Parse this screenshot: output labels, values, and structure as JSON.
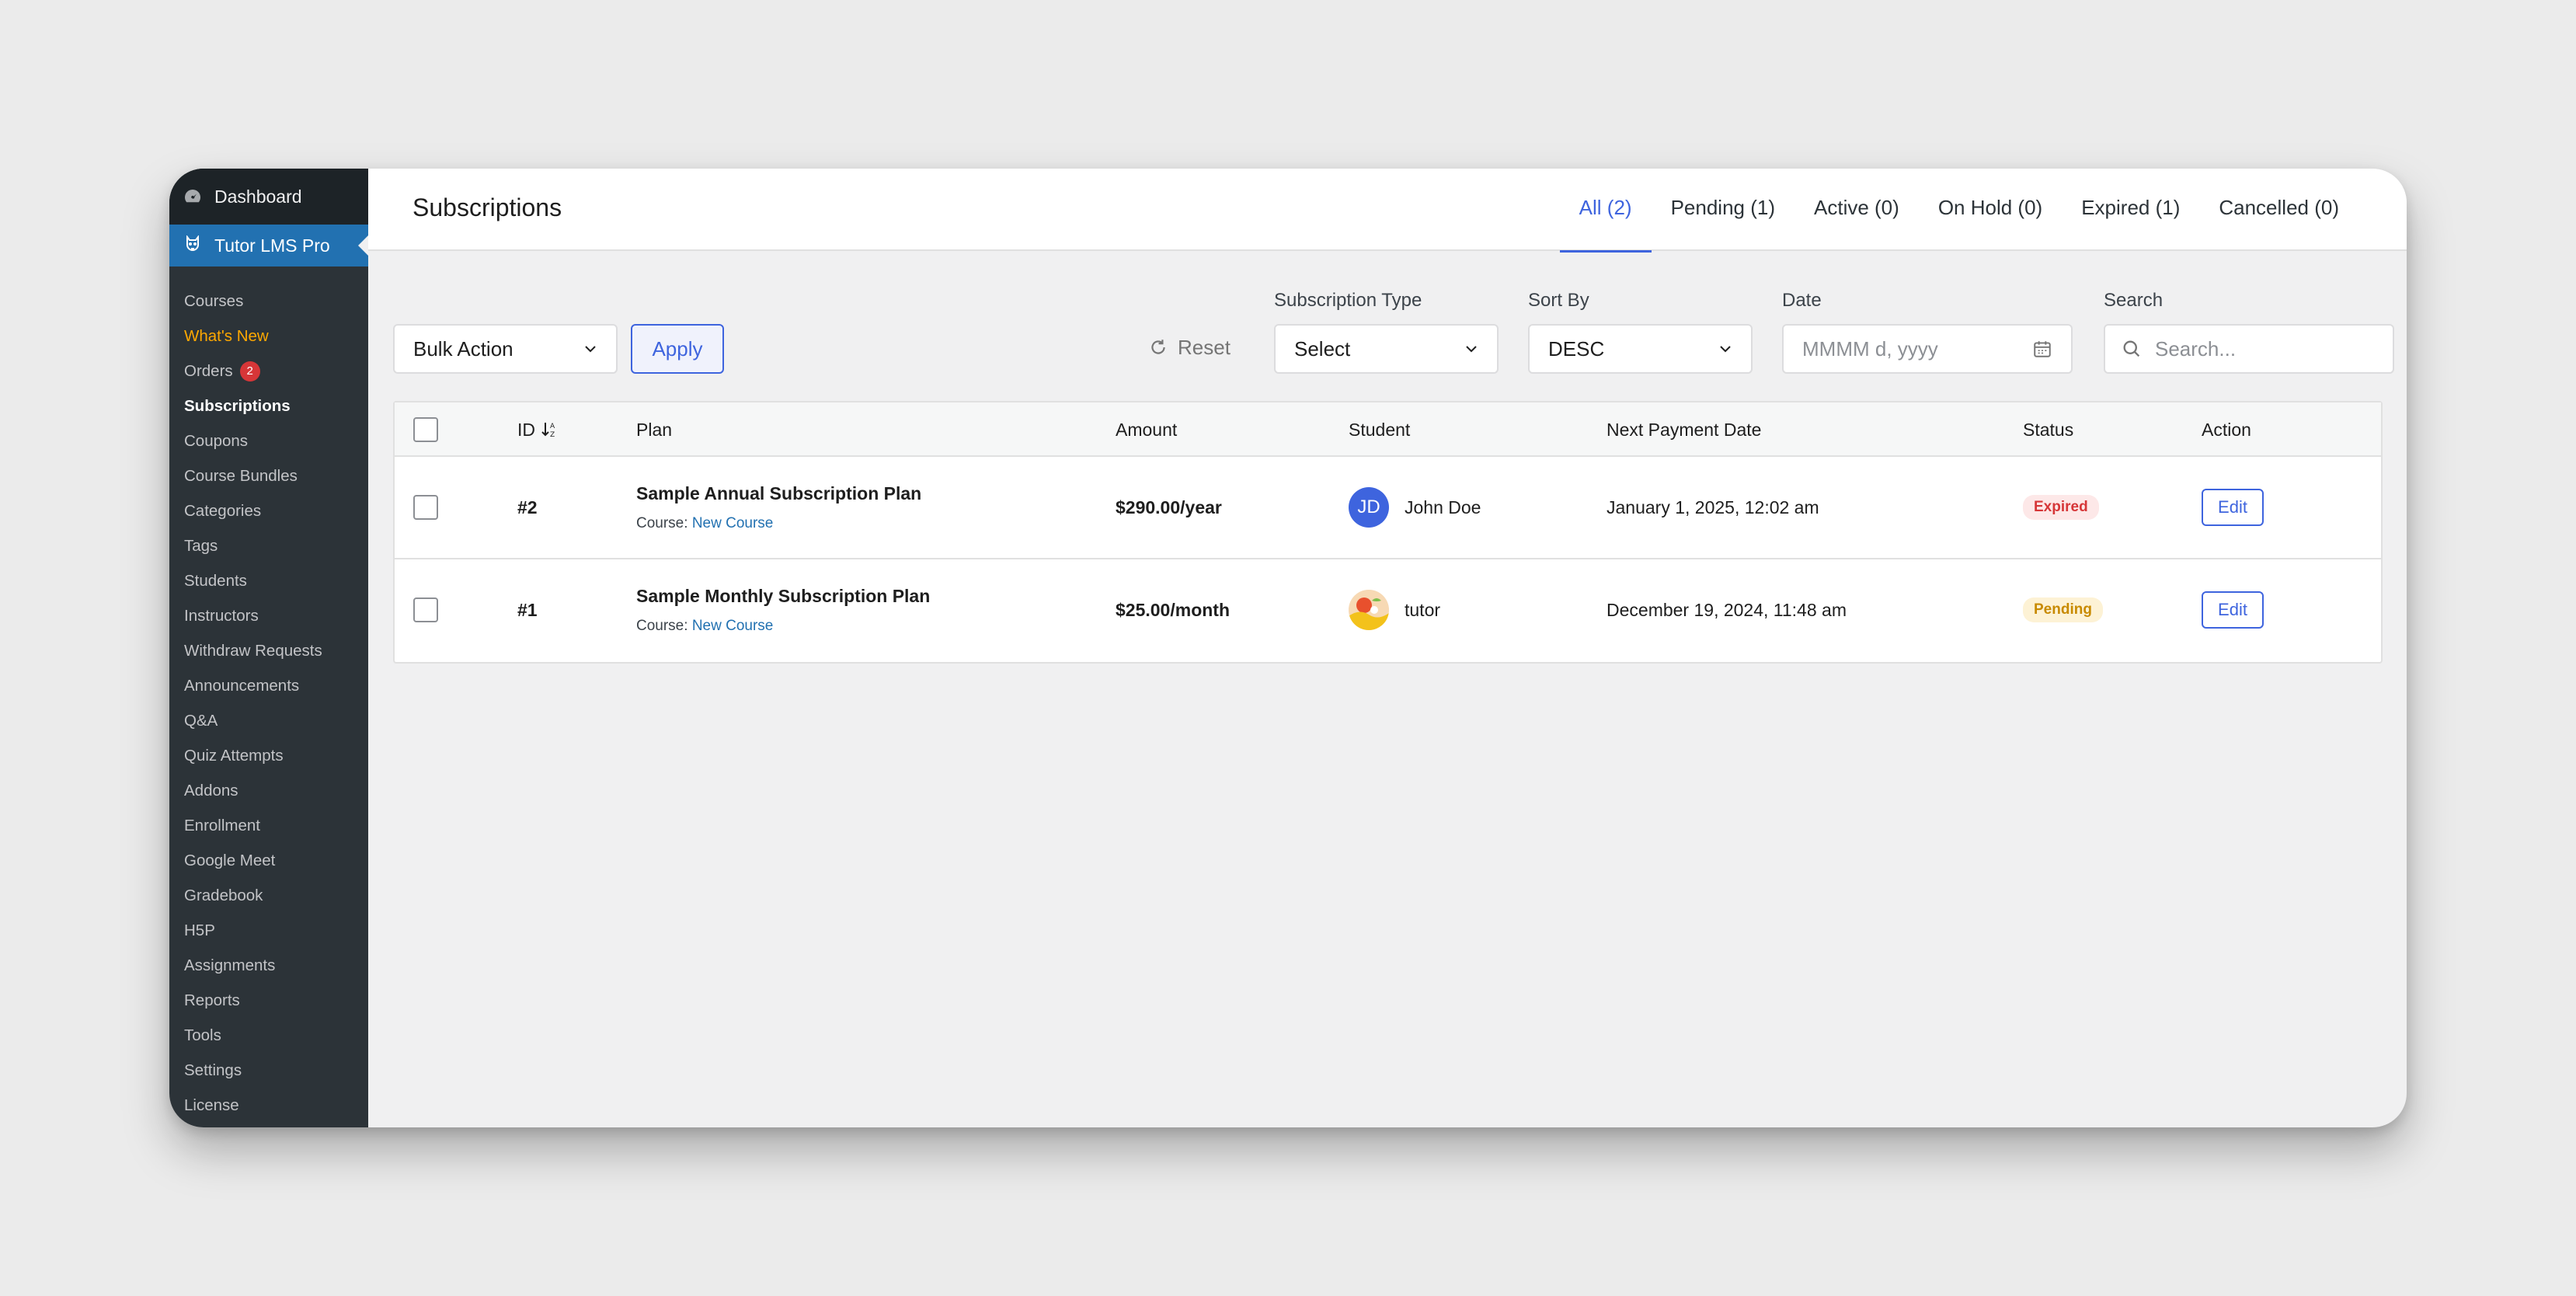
{
  "sidebar": {
    "dashboard": "Dashboard",
    "plugin": "Tutor LMS Pro",
    "items": [
      {
        "label": "Courses"
      },
      {
        "label": "What's New"
      },
      {
        "label": "Orders",
        "badge": "2"
      },
      {
        "label": "Subscriptions"
      },
      {
        "label": "Coupons"
      },
      {
        "label": "Course Bundles"
      },
      {
        "label": "Categories"
      },
      {
        "label": "Tags"
      },
      {
        "label": "Students"
      },
      {
        "label": "Instructors"
      },
      {
        "label": "Withdraw Requests"
      },
      {
        "label": "Announcements"
      },
      {
        "label": "Q&A"
      },
      {
        "label": "Quiz Attempts"
      },
      {
        "label": "Addons"
      },
      {
        "label": "Enrollment"
      },
      {
        "label": "Google Meet"
      },
      {
        "label": "Gradebook"
      },
      {
        "label": "H5P"
      },
      {
        "label": "Assignments"
      },
      {
        "label": "Reports"
      },
      {
        "label": "Tools"
      },
      {
        "label": "Settings"
      },
      {
        "label": "License"
      }
    ]
  },
  "header": {
    "title": "Subscriptions",
    "tabs": [
      {
        "label": "All (2)",
        "active": true
      },
      {
        "label": "Pending (1)"
      },
      {
        "label": "Active (0)"
      },
      {
        "label": "On Hold (0)"
      },
      {
        "label": "Expired (1)"
      },
      {
        "label": "Cancelled (0)"
      }
    ]
  },
  "filters": {
    "bulk_action": "Bulk Action",
    "apply": "Apply",
    "reset": "Reset",
    "subscription_type_label": "Subscription Type",
    "subscription_type_value": "Select",
    "sort_by_label": "Sort By",
    "sort_by_value": "DESC",
    "date_label": "Date",
    "date_placeholder": "MMMM d, yyyy",
    "search_label": "Search",
    "search_placeholder": "Search..."
  },
  "table": {
    "headers": {
      "id": "ID",
      "plan": "Plan",
      "amount": "Amount",
      "student": "Student",
      "next_payment": "Next Payment Date",
      "status": "Status",
      "action": "Action"
    },
    "rows": [
      {
        "id": "#2",
        "plan": "Sample Annual Subscription Plan",
        "course_prefix": "Course:",
        "course": "New Course",
        "amount": "$290.00/year",
        "student": "John Doe",
        "avatar_initials": "JD",
        "next_payment": "January 1, 2025, 12:02 am",
        "status": "Expired",
        "action": "Edit"
      },
      {
        "id": "#1",
        "plan": "Sample Monthly Subscription Plan",
        "course_prefix": "Course:",
        "course": "New Course",
        "amount": "$25.00/month",
        "student": "tutor",
        "avatar_initials": "",
        "next_payment": "December 19, 2024, 11:48 am",
        "status": "Pending",
        "action": "Edit"
      }
    ]
  },
  "colors": {
    "accent": "#3e64de",
    "sidebar_bg": "#2c3338",
    "sidebar_current": "#2271b1",
    "expired": "#d63638",
    "pending": "#c88a00"
  }
}
